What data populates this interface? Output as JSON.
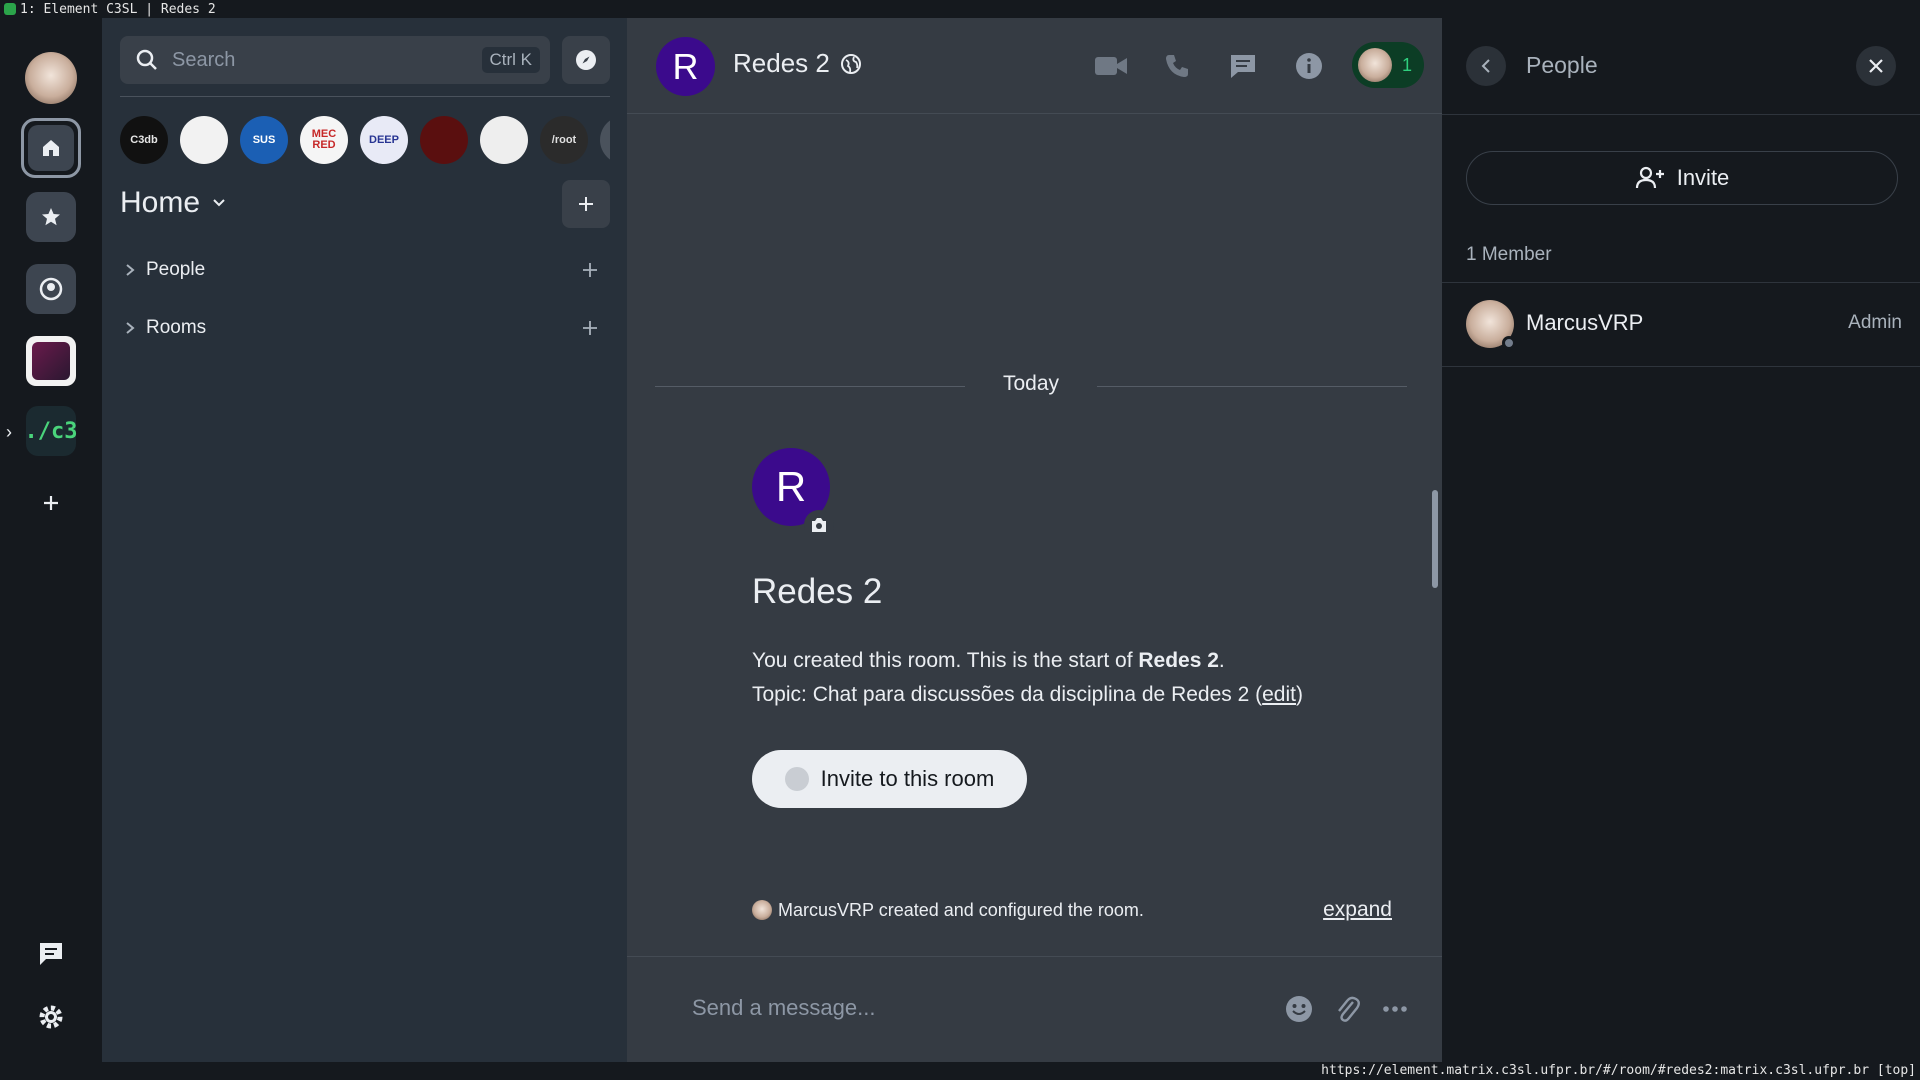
{
  "window": {
    "title": "1: Element C3SL | Redes 2"
  },
  "statusbar": {
    "url": "https://element.matrix.c3sl.ufpr.br/#/room/#redes2:matrix.c3sl.ufpr.br [top]"
  },
  "spaces": {
    "items": [
      {
        "name": "home",
        "icon": "home-icon"
      },
      {
        "name": "favourites",
        "icon": "star-icon"
      },
      {
        "name": "people",
        "icon": "person-circle-icon"
      },
      {
        "name": "space-1",
        "icon": "space-image-icon"
      },
      {
        "name": "space-c3",
        "label": "./c3"
      }
    ],
    "create_icon": "plus-icon",
    "threads_icon": "threads-icon",
    "settings_icon": "gear-icon"
  },
  "roomlist": {
    "search_placeholder": "Search",
    "search_shortcut": "Ctrl K",
    "recent_rooms": [
      {
        "label": "C3db",
        "bg": "#111111",
        "fg": "#e6e6e6"
      },
      {
        "label": "",
        "bg": "#f2f2f2",
        "fg": "#222222"
      },
      {
        "label": "SUS",
        "bg": "#1b5fb4",
        "fg": "#ffffff"
      },
      {
        "label": "MEC RED",
        "bg": "#f5f5f5",
        "fg": "#c62828"
      },
      {
        "label": "DEEP",
        "bg": "#e8eaf6",
        "fg": "#283593"
      },
      {
        "label": "",
        "bg": "#5a0f0f",
        "fg": "#ff9800"
      },
      {
        "label": "",
        "bg": "#eeeeee",
        "fg": "#333333"
      },
      {
        "label": "/root",
        "bg": "#2b2b2b",
        "fg": "#e0e0e0"
      }
    ],
    "home_title": "Home",
    "sections": [
      {
        "label": "People"
      },
      {
        "label": "Rooms"
      }
    ]
  },
  "room": {
    "avatar_letter": "R",
    "name": "Redes 2",
    "header_icons": [
      "video-call-icon",
      "voice-call-icon",
      "threads-icon",
      "room-info-icon"
    ],
    "member_count": "1",
    "date_separator": "Today",
    "new_room": {
      "title": "Redes 2",
      "created_prefix": "You created this room. This is the start of ",
      "created_room": "Redes 2",
      "created_suffix": ".",
      "topic_prefix": "Topic: Chat para discussões da disciplina de Redes 2 (",
      "topic_edit": "edit",
      "topic_suffix": ")",
      "invite_button": "Invite to this room"
    },
    "summary": {
      "text": "MarcusVRP created and configured the room.",
      "expand": "expand"
    },
    "composer_placeholder": "Send a message..."
  },
  "right_panel": {
    "title": "People",
    "invite_label": "Invite",
    "member_count_label": "1 Member",
    "members": [
      {
        "name": "MarcusVRP",
        "role": "Admin"
      }
    ]
  }
}
